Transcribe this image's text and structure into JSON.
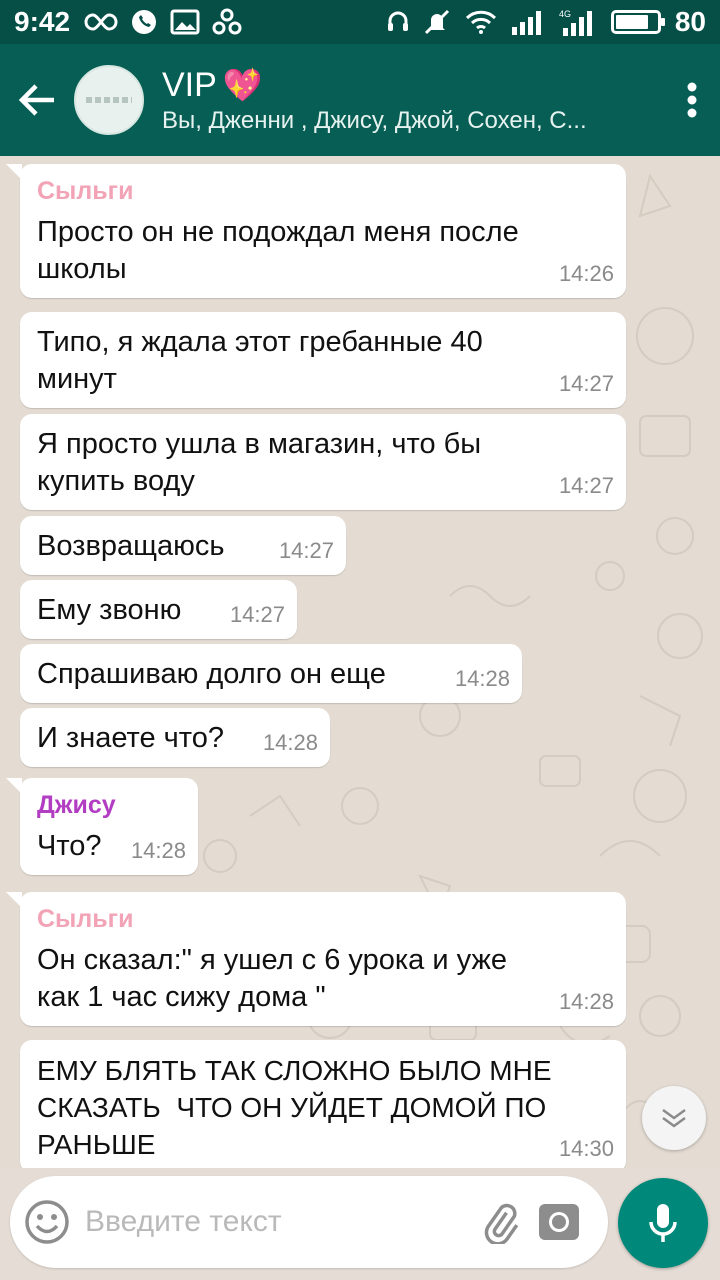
{
  "status_bar": {
    "time": "9:42",
    "network": "4G",
    "battery": "80",
    "battery_fraction": 0.8
  },
  "header": {
    "title": "VIP",
    "title_emoji": "💖",
    "subtitle": "Вы, Дженни , Джису, Джой, Сохен, С...",
    "back_icon": "arrow-left-icon",
    "menu_icon": "more-vertical-icon"
  },
  "messages": [
    {
      "sender": "Сыльги",
      "text": "Просто он не подождал меня после\nшколы",
      "time": "14:26"
    },
    {
      "sender": "",
      "text": "Типо, я ждала этот гребанные 40\nминут",
      "time": "14:27"
    },
    {
      "sender": "",
      "text": "Я просто ушла в магазин, что бы\nкупить воду",
      "time": "14:27"
    },
    {
      "sender": "",
      "text": "Возвращаюсь",
      "time": "14:27"
    },
    {
      "sender": "",
      "text": "Ему звоню",
      "time": "14:27"
    },
    {
      "sender": "",
      "text": "Спрашиваю долго он еще",
      "time": "14:28"
    },
    {
      "sender": "",
      "text": "И знаете что?",
      "time": "14:28"
    },
    {
      "sender": "Джису",
      "text": "Что?",
      "time": "14:28"
    },
    {
      "sender": "Сыльги",
      "text": "Он сказал:\" я ушел с 6 урока и уже\nкак 1 час сижу дома \"",
      "time": "14:28"
    },
    {
      "sender": "",
      "text": "ЕМУ БЛЯТЬ ТАК СЛОЖНО БЫЛО МНЕ\nСКАЗАТЬ  ЧТО ОН УЙДЕТ ДОМОЙ ПО\nРАНЬШЕ",
      "time": "14:30"
    }
  ],
  "colors": {
    "header": "#075e54",
    "statusbar": "#054f47",
    "sender_seulgi": "#f2a3b6",
    "sender_jisoo": "#b23cc2",
    "mic_button": "#00897b"
  },
  "input": {
    "placeholder": "Введите текст",
    "emoji_icon": "emoji-icon",
    "attach_icon": "paperclip-icon",
    "camera_icon": "camera-icon",
    "mic_icon": "mic-icon"
  }
}
